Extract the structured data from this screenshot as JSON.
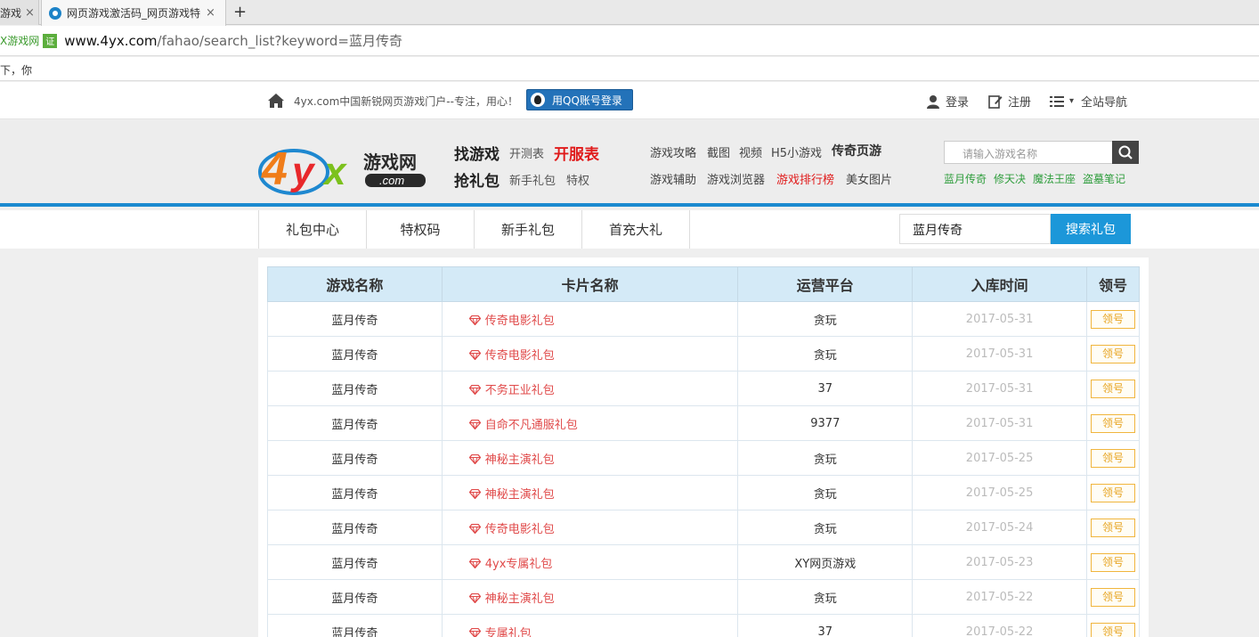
{
  "browser": {
    "tabs": [
      {
        "label": "游戏",
        "active": false
      },
      {
        "label": "网页游戏激活码_网页游戏特",
        "active": true
      }
    ],
    "close_glyph": "×",
    "new_tab_glyph": "+",
    "site_tag": "X游戏网",
    "cert_label": "证",
    "url_host": "www.4yx.com",
    "url_path": "/fahao/search_list?keyword=蓝月传奇",
    "bookmark_text": "下，你"
  },
  "topbar": {
    "slogan": "4yx.com中国新锐网页游戏门户--专注，用心！",
    "qq_login": "用QQ账号登录",
    "login": "登录",
    "register": "注册",
    "site_nav": "全站导航",
    "caret": "▾"
  },
  "header": {
    "find_game": "找游戏",
    "test_table": "开测表",
    "open_table": "开服表",
    "grab_gift": "抢礼包",
    "newbie_gift": "新手礼包",
    "privilege": "特权",
    "nav_row1": [
      "游戏攻略",
      "截图",
      "视频",
      "H5小游戏",
      "传奇页游"
    ],
    "nav_row2": [
      "游戏辅助",
      "游戏浏览器",
      "游戏排行榜",
      "美女图片"
    ],
    "search_placeholder": "请输入游戏名称",
    "hot_keywords": [
      "蓝月传奇",
      "修天决",
      "魔法王座",
      "盗墓笔记"
    ]
  },
  "subnav": {
    "items": [
      "礼包中心",
      "特权码",
      "新手礼包",
      "首充大礼"
    ],
    "search_value": "蓝月传奇",
    "search_button": "搜索礼包"
  },
  "table": {
    "headers": [
      "游戏名称",
      "卡片名称",
      "运营平台",
      "入库时间",
      "领号"
    ],
    "claim_label": "领号",
    "rows": [
      {
        "game": "蓝月传奇",
        "card": "传奇电影礼包",
        "platform": "贪玩",
        "date": "2017-05-31"
      },
      {
        "game": "蓝月传奇",
        "card": "传奇电影礼包",
        "platform": "贪玩",
        "date": "2017-05-31"
      },
      {
        "game": "蓝月传奇",
        "card": "不务正业礼包",
        "platform": "37",
        "date": "2017-05-31"
      },
      {
        "game": "蓝月传奇",
        "card": "自命不凡通服礼包",
        "platform": "9377",
        "date": "2017-05-31"
      },
      {
        "game": "蓝月传奇",
        "card": "神秘主演礼包",
        "platform": "贪玩",
        "date": "2017-05-25"
      },
      {
        "game": "蓝月传奇",
        "card": "神秘主演礼包",
        "platform": "贪玩",
        "date": "2017-05-25"
      },
      {
        "game": "蓝月传奇",
        "card": "传奇电影礼包",
        "platform": "贪玩",
        "date": "2017-05-24"
      },
      {
        "game": "蓝月传奇",
        "card": "4yx专属礼包",
        "platform": "XY网页游戏",
        "date": "2017-05-23"
      },
      {
        "game": "蓝月传奇",
        "card": "神秘主演礼包",
        "platform": "贪玩",
        "date": "2017-05-22"
      },
      {
        "game": "蓝月传奇",
        "card": "专属礼包",
        "platform": "37",
        "date": "2017-05-22"
      }
    ]
  },
  "colors": {
    "accent": "#1c97d9",
    "red": "#e01b1b",
    "green": "#2e9d3c",
    "claim": "#f0b53d"
  }
}
